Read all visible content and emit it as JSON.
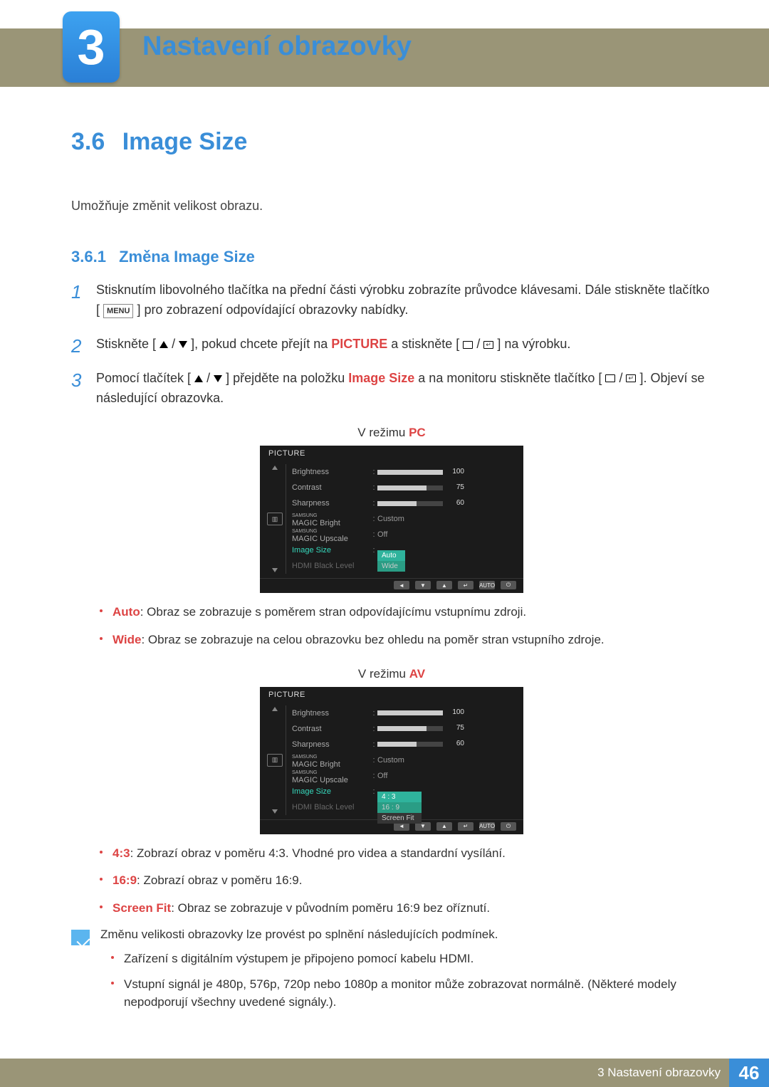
{
  "chapter": {
    "number": "3",
    "title": "Nastavení obrazovky"
  },
  "section": {
    "number": "3.6",
    "title": "Image Size",
    "intro": "Umožňuje změnit velikost obrazu."
  },
  "subsection": {
    "number": "3.6.1",
    "title": "Změna Image Size"
  },
  "steps": {
    "s1a": "Stisknutím libovolného tlačítka na přední části výrobku zobrazíte průvodce klávesami. Dále stiskněte tlačítko [",
    "s1menu": "MENU",
    "s1b": "] pro zobrazení odpovídající obrazovky nabídky.",
    "s2a": "Stiskněte [",
    "s2b": "], pokud chcete přejít na ",
    "s2pic": "PICTURE",
    "s2c": " a stiskněte [",
    "s2d": "] na výrobku.",
    "s3a": "Pomocí tlačítek [",
    "s3b": "] přejděte na položku ",
    "s3img": "Image Size",
    "s3c": " a na monitoru stiskněte tlačítko [",
    "s3d": "]. Objeví se následující obrazovka."
  },
  "mode_pc_prefix": "V režimu ",
  "mode_pc_suffix": "PC",
  "mode_av_prefix": "V režimu ",
  "mode_av_suffix": "AV",
  "osd": {
    "title": "PICTURE",
    "rows": {
      "brightness": "Brightness",
      "contrast": "Contrast",
      "sharpness": "Sharpness",
      "magic_bright_pfx": "SAMSUNG",
      "magic_bright": "MAGIC",
      "magic_bright_sfx": " Bright",
      "magic_upscale_sfx": " Upscale",
      "image_size": "Image Size",
      "hdmi_black": "HDMI Black Level"
    },
    "vals": {
      "v100": "100",
      "v75": "75",
      "v60": "60",
      "custom": "Custom",
      "off": "Off"
    },
    "pc_dropdown": {
      "a": "Auto",
      "b": "Wide"
    },
    "av_dropdown": {
      "a": "4 : 3",
      "b": "16 : 9",
      "c": "Screen Fit"
    },
    "nav": {
      "auto": "AUTO"
    }
  },
  "bullets_pc": {
    "auto_t": "Auto",
    "auto_d": ": Obraz se zobrazuje s poměrem stran odpovídajícímu vstupnímu zdroji.",
    "wide_t": "Wide",
    "wide_d": ": Obraz se zobrazuje na celou obrazovku bez ohledu na poměr stran vstupního zdroje."
  },
  "bullets_av": {
    "b43_t": "4:3",
    "b43_d": ": Zobrazí obraz v poměru 4:3. Vhodné pro videa a standardní vysílání.",
    "b169_t": "16:9",
    "b169_d": ": Zobrazí obraz v poměru 16:9.",
    "sf_t": "Screen Fit",
    "sf_d": ": Obraz se zobrazuje v původním poměru 16:9 bez oříznutí."
  },
  "note": {
    "lead": "Změnu velikosti obrazovky lze provést po splnění následujících podmínek.",
    "n1": "Zařízení s digitálním výstupem je připojeno pomocí kabelu HDMI.",
    "n2": "Vstupní signál je 480p, 576p, 720p nebo 1080p a monitor může zobrazovat normálně. (Některé modely nepodporují všechny uvedené signály.)."
  },
  "footer": {
    "text": "3 Nastavení obrazovky",
    "page": "46"
  },
  "chart_data": {
    "type": "bar",
    "title": "PICTURE OSD sliders",
    "categories": [
      "Brightness",
      "Contrast",
      "Sharpness"
    ],
    "values": [
      100,
      75,
      60
    ],
    "ylim": [
      0,
      100
    ]
  }
}
